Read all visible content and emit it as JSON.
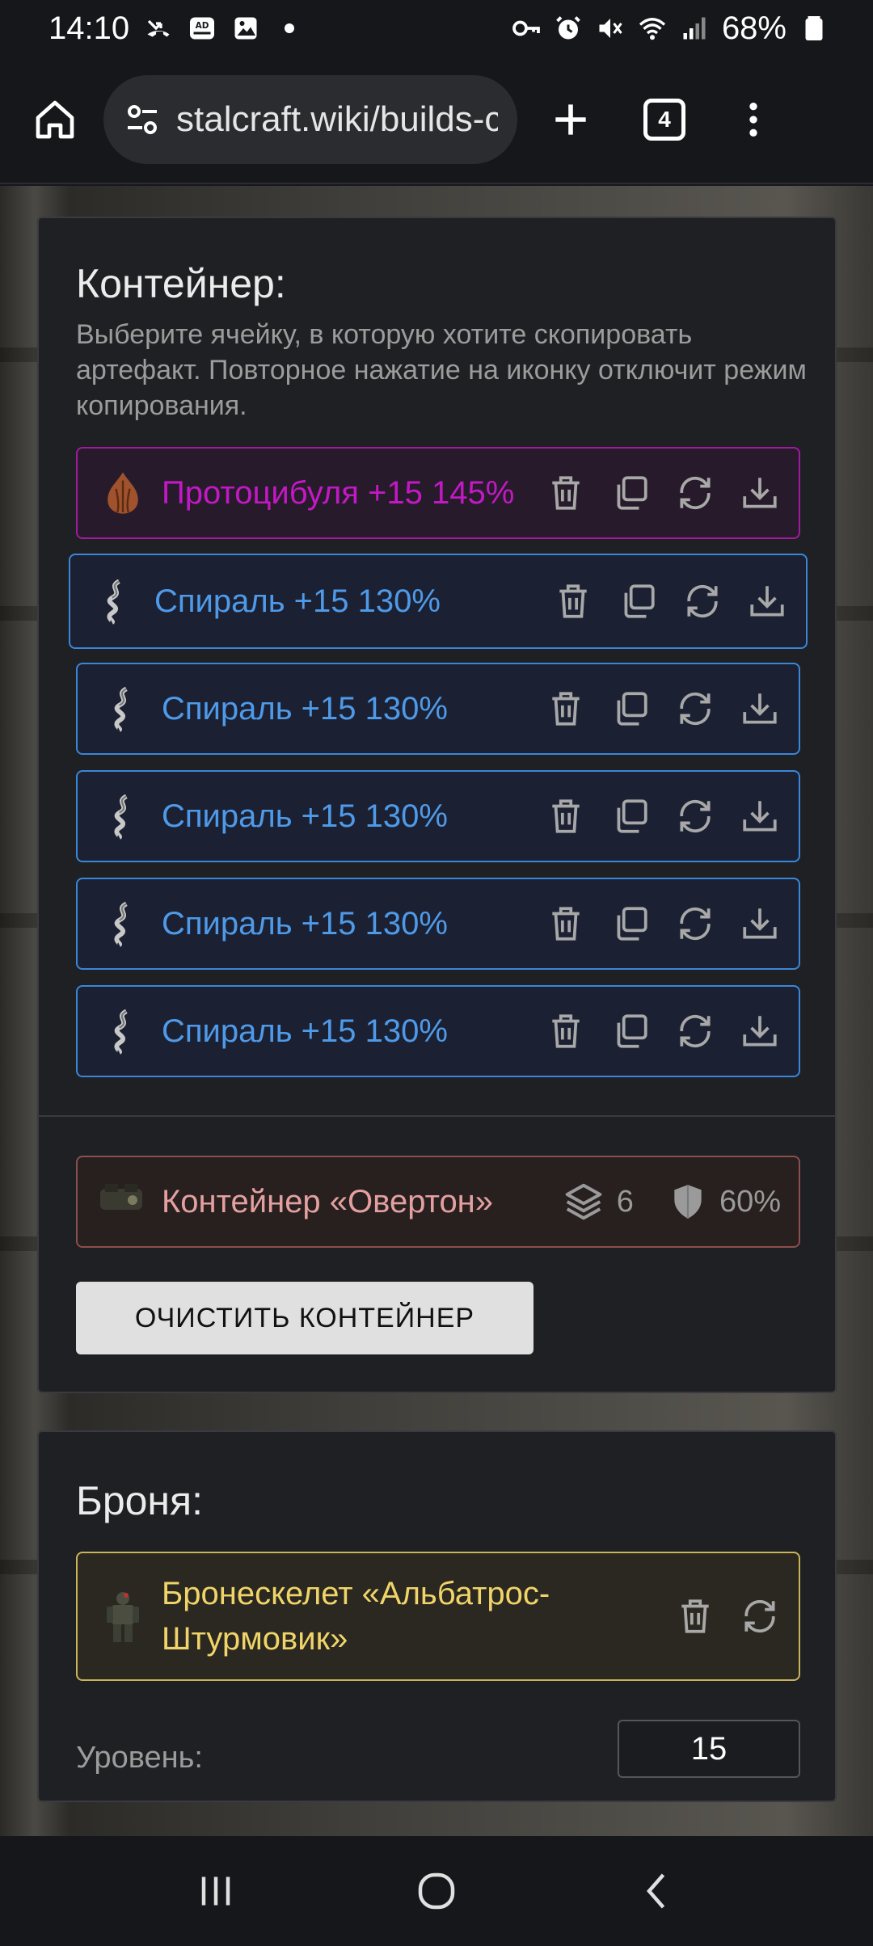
{
  "status_bar": {
    "time": "14:10",
    "battery": "68%",
    "adblock_label": "AD BLOCKER"
  },
  "browser": {
    "url": "stalcraft.wiki/builds-c",
    "tabs_count": "4"
  },
  "container_panel": {
    "title": "Контейнер:",
    "description": "Выберите ячейку, в которую хотите скопировать артефакт. Повторное нажатие на иконку отключит режим копирования.",
    "slots": [
      {
        "name": "Протоцибуля +15 145%"
      },
      {
        "name": "Спираль +15 130%"
      },
      {
        "name": "Спираль +15 130%"
      },
      {
        "name": "Спираль +15 130%"
      },
      {
        "name": "Спираль +15 130%"
      },
      {
        "name": "Спираль +15 130%"
      }
    ],
    "container": {
      "name": "Контейнер «Овертон»",
      "slots_count": "6",
      "protection": "60%"
    },
    "clear_button": "ОЧИСТИТЬ КОНТЕЙНЕР"
  },
  "armor_panel": {
    "title": "Броня:",
    "armor_name": "Бронескелет «Альбатрос-Штурмовик»",
    "level_label": "Уровень:",
    "level_value": "15"
  },
  "colors": {
    "legendary_purple": "#c219c4",
    "rare_blue": "#4f9ae8",
    "container_red": "#e4a0a0",
    "armor_gold": "#f0d46a"
  }
}
